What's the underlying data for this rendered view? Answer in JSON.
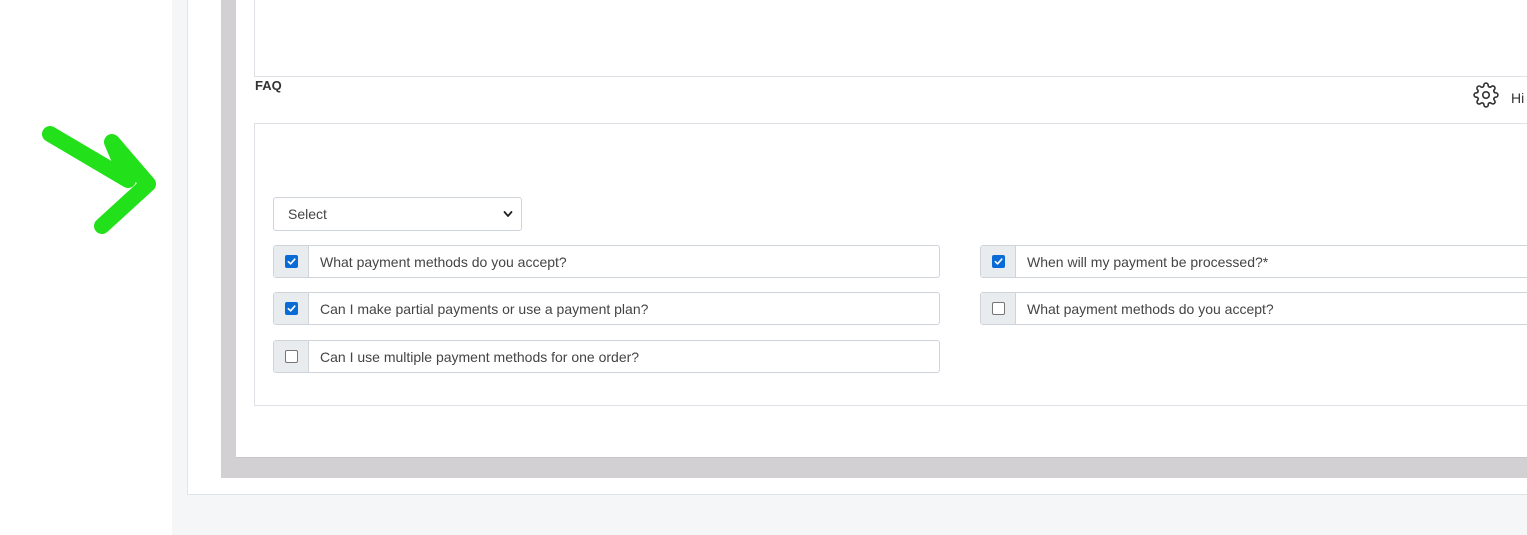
{
  "faq": {
    "section_label": "FAQ",
    "hide_label": "Hi",
    "select": {
      "value": "Select"
    },
    "questions": [
      {
        "text": "What payment methods do you accept?",
        "checked": true
      },
      {
        "text": "When will my payment be processed?*",
        "checked": true
      },
      {
        "text": "Can I make partial payments or use a payment plan?",
        "checked": true
      },
      {
        "text": "What payment methods do you accept?",
        "checked": false
      },
      {
        "text": "Can I use multiple payment methods for one order?",
        "checked": false
      }
    ]
  },
  "icons": {
    "gear": "gear-icon",
    "arrow": "arrow-annotation",
    "check": "check-icon",
    "chevron": "chevron-down-icon"
  },
  "colors": {
    "checkbox_checked": "#0b6bd6",
    "annotation_arrow": "#22e01a",
    "frame": "#d2d0d2"
  }
}
